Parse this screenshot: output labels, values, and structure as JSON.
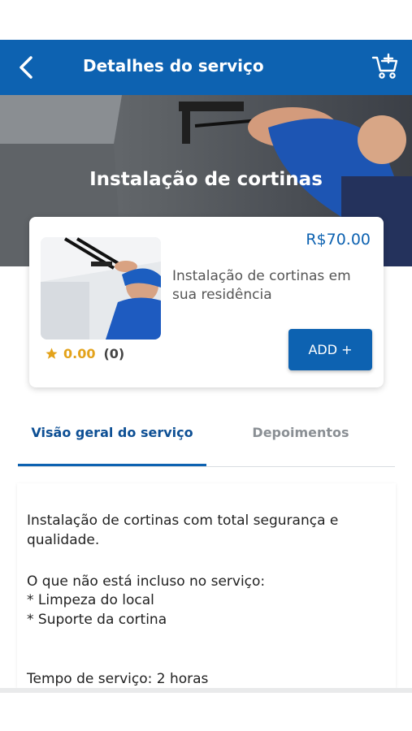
{
  "header": {
    "title": "Detalhes do serviço",
    "back_icon": "back-arrow-icon",
    "cart_icon": "cart-add-icon",
    "color": "#0d62b1"
  },
  "hero": {
    "title": "Instalação de cortinas"
  },
  "service": {
    "price": "R$70.00",
    "description": "Instalação de cortinas em sua residência",
    "rating": "0.00",
    "review_count": "(0)",
    "add_label": "ADD +",
    "star_color": "#e3a21a"
  },
  "tabs": {
    "overview": "Visão geral do serviço",
    "testimonials": "Depoimentos"
  },
  "overview": {
    "paragraph1_line1": "Instalação de cortinas com total segurança e",
    "paragraph1_line2": "qualidade.",
    "not_included_title": "O que não está incluso no serviço:",
    "not_included_1": "* Limpeza do local",
    "not_included_2": "* Suporte da cortina",
    "service_time": "Tempo de serviço: 2 horas"
  }
}
